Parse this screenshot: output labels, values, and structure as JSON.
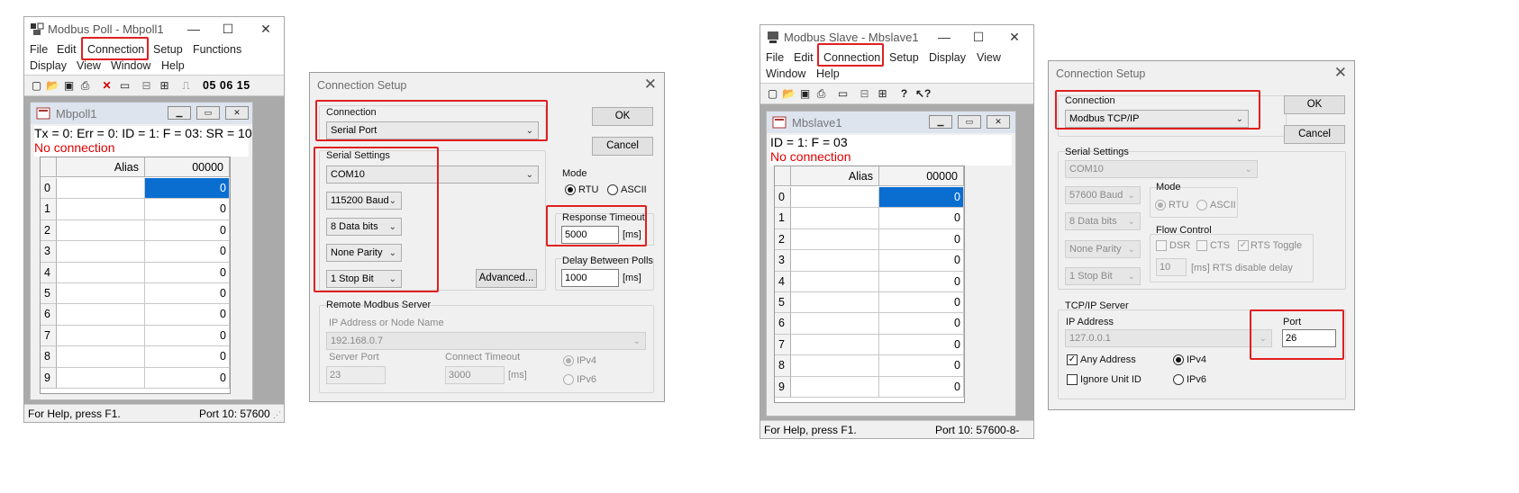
{
  "poll": {
    "title": "Modbus Poll - Mbpoll1",
    "menu": [
      "File",
      "Edit",
      "Connection",
      "Setup",
      "Functions",
      "Display",
      "View",
      "Window",
      "Help"
    ],
    "toolbar_codes": "05 06 15",
    "child_title": "Mbpoll1",
    "info_line": "Tx = 0: Err = 0: ID = 1: F = 03: SR = 10",
    "no_connection": "No connection",
    "col_alias": "Alias",
    "col_addr": "00000",
    "rows": [
      "0",
      "1",
      "2",
      "3",
      "4",
      "5",
      "6",
      "7",
      "8",
      "9"
    ],
    "values": [
      "0",
      "0",
      "0",
      "0",
      "0",
      "0",
      "0",
      "0",
      "0",
      "0"
    ],
    "status_help": "For Help, press F1.",
    "status_port": "Port 10: 57600"
  },
  "poll_dialog": {
    "title": "Connection Setup",
    "connection_label": "Connection",
    "connection_value": "Serial Port",
    "ok": "OK",
    "cancel": "Cancel",
    "serial_label": "Serial Settings",
    "com": "COM10",
    "baud": "115200 Baud",
    "data_bits": "8 Data bits",
    "parity": "None Parity",
    "stop_bits": "1 Stop Bit",
    "advanced": "Advanced...",
    "mode_label": "Mode",
    "rtu": "RTU",
    "ascii": "ASCII",
    "response_label": "Response Timeout",
    "response_value": "5000",
    "ms": "[ms]",
    "delay_label": "Delay Between Polls",
    "delay_value": "1000",
    "remote_label": "Remote Modbus Server",
    "ip_label": "IP Address or Node Name",
    "ip_value": "192.168.0.7",
    "server_port_label": "Server Port",
    "server_port_value": "23",
    "connect_timeout_label": "Connect Timeout",
    "connect_timeout_value": "3000",
    "ipv4": "IPv4",
    "ipv6": "IPv6"
  },
  "slave": {
    "title": "Modbus Slave - Mbslave1",
    "menu": [
      "File",
      "Edit",
      "Connection",
      "Setup",
      "Display",
      "View",
      "Window",
      "Help"
    ],
    "child_title": "Mbslave1",
    "info_line": "ID = 1: F = 03",
    "no_connection": "No connection",
    "col_alias": "Alias",
    "col_addr": "00000",
    "rows": [
      "0",
      "1",
      "2",
      "3",
      "4",
      "5",
      "6",
      "7",
      "8",
      "9"
    ],
    "values": [
      "0",
      "0",
      "0",
      "0",
      "0",
      "0",
      "0",
      "0",
      "0",
      "0"
    ],
    "status_help": "For Help, press F1.",
    "status_port": "Port 10: 57600-8-"
  },
  "slave_dialog": {
    "title": "Connection Setup",
    "connection_label": "Connection",
    "connection_value": "Modbus TCP/IP",
    "ok": "OK",
    "cancel": "Cancel",
    "serial_label": "Serial Settings",
    "com": "COM10",
    "baud": "57600 Baud",
    "data_bits": "8 Data bits",
    "parity": "None Parity",
    "stop_bits": "1 Stop Bit",
    "mode_label": "Mode",
    "rtu": "RTU",
    "ascii": "ASCII",
    "flow_label": "Flow Control",
    "dsr": "DSR",
    "cts": "CTS",
    "rts_toggle": "RTS Toggle",
    "rts_delay_value": "10",
    "rts_delay_label": "[ms] RTS disable delay",
    "tcp_label": "TCP/IP Server",
    "ip_label": "IP Address",
    "ip_value": "127.0.0.1",
    "port_label": "Port",
    "port_value": "26",
    "any_address": "Any Address",
    "ignore_unit": "Ignore Unit ID",
    "ipv4": "IPv4",
    "ipv6": "IPv6"
  },
  "colors": {
    "highlight": "#e02020",
    "selected": "#0a6ed1",
    "no_connection": "#e00000"
  }
}
